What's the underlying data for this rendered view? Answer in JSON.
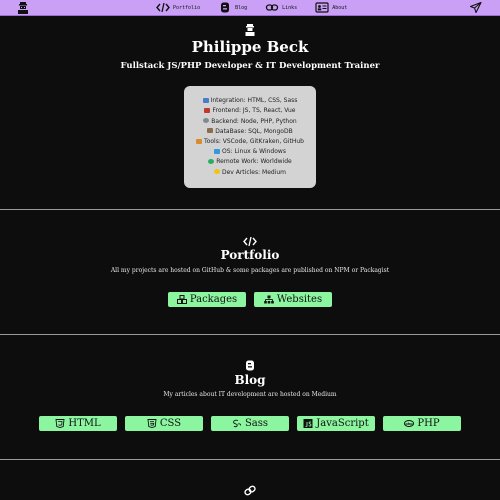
{
  "nav": {
    "items": [
      {
        "label": "Portfolio",
        "icon": "code-icon"
      },
      {
        "label": "Blog",
        "icon": "blogger-icon"
      },
      {
        "label": "Links",
        "icon": "link-icon"
      },
      {
        "label": "About",
        "icon": "id-card-icon"
      }
    ]
  },
  "header": {
    "name": "Philippe Beck",
    "tagline": "Fullstack JS/PHP Developer & IT Development Trainer",
    "skills": [
      {
        "text": "Integration: HTML, CSS, Sass",
        "icon": "monitor-icon",
        "color": "#4a7cc7"
      },
      {
        "text": "Frontend: JS, TS, React, Vue",
        "icon": "pointer-icon",
        "color": "#c0392b"
      },
      {
        "text": "Backend: Node, PHP, Python",
        "icon": "gear-icon",
        "color": "#7f8c8d"
      },
      {
        "text": "DataBase: SQL, MongoDB",
        "icon": "cabinet-icon",
        "color": "#8a6d4f"
      },
      {
        "text": "Tools: VSCode, GitKraken, GitHub",
        "icon": "tools-icon",
        "color": "#d98c2b"
      },
      {
        "text": "OS: Linux & Windows",
        "icon": "laptop-icon",
        "color": "#3498db"
      },
      {
        "text": "Remote Work: Worldwide",
        "icon": "globe-icon",
        "color": "#27ae60"
      },
      {
        "text": "Dev Articles: Medium",
        "icon": "star-icon",
        "color": "#f1c40f"
      }
    ]
  },
  "portfolio": {
    "title": "Portfolio",
    "description": "All my projects are hosted on GitHub & some packages are published on NPM or Packagist",
    "buttons": [
      {
        "label": "Packages",
        "icon": "cubes-icon"
      },
      {
        "label": "Websites",
        "icon": "sitemap-icon"
      }
    ]
  },
  "blog": {
    "title": "Blog",
    "description": "My articles about IT development are hosted on Medium",
    "buttons": [
      {
        "label": "HTML",
        "icon": "html5-icon"
      },
      {
        "label": "CSS",
        "icon": "css3-icon"
      },
      {
        "label": "Sass",
        "icon": "sass-icon"
      },
      {
        "label": "JavaScript",
        "icon": "js-icon"
      },
      {
        "label": "PHP",
        "icon": "php-icon"
      }
    ]
  },
  "colors": {
    "nav_bg": "#c9a0f5",
    "page_bg": "#0d0d0d",
    "button_bg": "#8cf5a0",
    "skills_bg": "#d3d3d3"
  }
}
